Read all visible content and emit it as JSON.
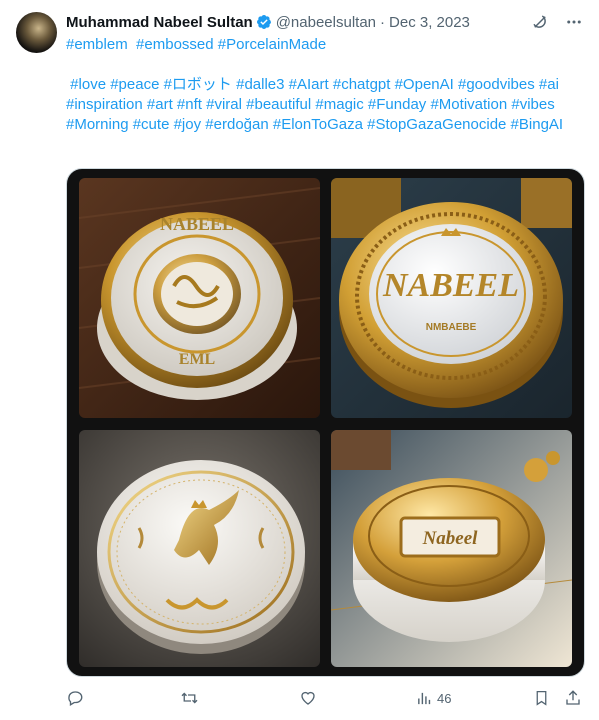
{
  "author": {
    "name": "Muhammad Nabeel Sultan",
    "handle": "@nabeelsultan",
    "separator": "·",
    "date": "Dec 3, 2023",
    "verified": true
  },
  "icons": {
    "verified": "verified-badge-icon",
    "grok": "grok-icon",
    "more": "more-icon",
    "reply": "reply-icon",
    "retweet": "retweet-icon",
    "like": "like-icon",
    "views": "views-icon",
    "bookmark": "bookmark-icon",
    "share": "share-icon"
  },
  "tweet": {
    "line1": [
      "#emblem",
      "#embossed",
      "#PorcelainMade"
    ],
    "tags": [
      "#love",
      "#peace",
      "#ロボット",
      "#dalle3",
      "#AIart",
      "#chatgpt",
      "#OpenAI",
      "#goodvibes",
      "#ai",
      "#inspiration",
      "#art",
      "#nft",
      "#viral",
      "#beautiful",
      "#magic",
      "#Funday",
      "#Motivation",
      "#vibes",
      "#Morning",
      "#cute",
      "#joy",
      "#erdoğan",
      "#ElonToGaza",
      "#StopGazaGenocide",
      "#BingAI"
    ]
  },
  "images": {
    "img1_text_top": "NABEEL",
    "img1_text_bottom": "EML",
    "img2_text_main": "NABEEL",
    "img2_text_small": "NMBAEBE",
    "img4_text": "Nabeel"
  },
  "stats": {
    "views": "46"
  },
  "colors": {
    "link": "#1d9bf0",
    "secondary": "#536471",
    "gold": "#c9962e"
  }
}
